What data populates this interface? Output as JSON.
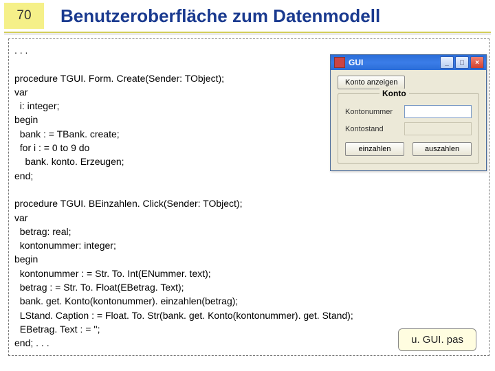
{
  "slide": {
    "number": "70",
    "title": "Benutzeroberfläche zum Datenmodell"
  },
  "code": {
    "ellipsis": ". . .",
    "proc1_head": "procedure TGUI. Form. Create(Sender: TObject);",
    "var": "var",
    "i_int": "  i: integer;",
    "begin": "begin",
    "bank_create": "  bank : = TBank. create;",
    "forloop": "  for i : = 0 to 9 do",
    "erzeugen": "    bank. konto. Erzeugen;",
    "endsemi": "end;",
    "blank": "",
    "proc2_head": "procedure TGUI. BEinzahlen. Click(Sender: TObject);",
    "betrag": "  betrag: real;",
    "knum": "  kontonummer: integer;",
    "kassign": "  kontonummer : = Str. To. Int(ENummer. text);",
    "bassign": "  betrag : = Str. To. Float(EBetrag. Text);",
    "einz": "  bank. get. Konto(kontonummer). einzahlen(betrag);",
    "lstand": "  LStand. Caption : = Float. To. Str(bank. get. Konto(kontonummer). get. Stand);",
    "ebetrag": "  EBetrag. Text : = '';",
    "end2": "end; . . ."
  },
  "win": {
    "title": "GUI",
    "show_btn": "Konto anzeigen",
    "group": "Konto",
    "label_num": "Kontonummer",
    "label_stand": "Kontostand",
    "btn_in": "einzahlen",
    "btn_out": "auszahlen"
  },
  "callout": "u. GUI. pas"
}
